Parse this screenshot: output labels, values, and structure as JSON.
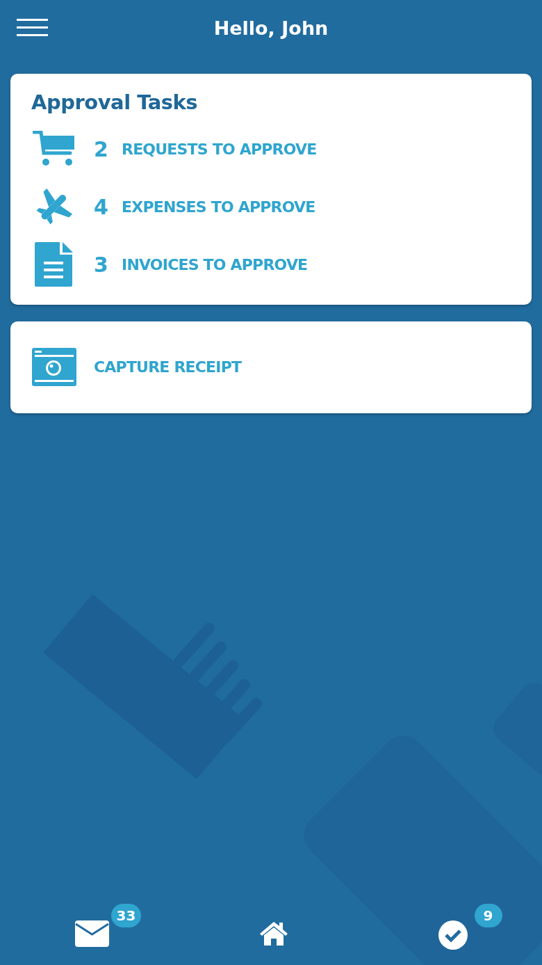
{
  "header": {
    "title": "Hello, John"
  },
  "approval_card": {
    "title": "Approval Tasks",
    "tasks": [
      {
        "kind": "cart",
        "count": "2",
        "label": "REQUESTS TO APPROVE"
      },
      {
        "kind": "plane",
        "count": "4",
        "label": "EXPENSES TO APPROVE"
      },
      {
        "kind": "document",
        "count": "3",
        "label": "INVOICES TO APPROVE"
      }
    ]
  },
  "capture_card": {
    "kind": "camera",
    "label": "CAPTURE RECEIPT"
  },
  "bottom_nav": [
    {
      "kind": "mail",
      "badge": "33"
    },
    {
      "kind": "home"
    },
    {
      "kind": "check",
      "badge": "9"
    }
  ]
}
